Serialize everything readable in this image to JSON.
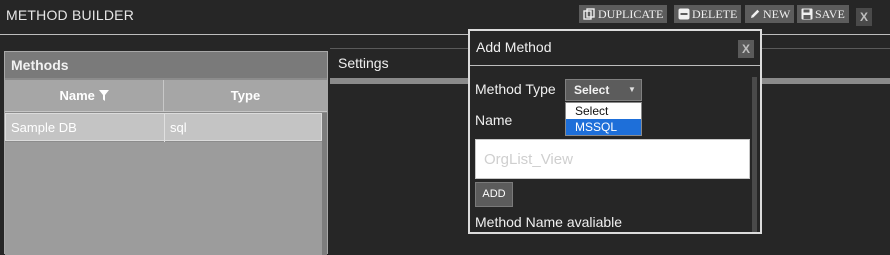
{
  "app": {
    "title": "METHOD BUILDER",
    "close_label": "X"
  },
  "toolbar": {
    "duplicate_label": "DUPLICATE",
    "delete_label": "DELETE",
    "new_label": "NEW",
    "save_label": "SAVE"
  },
  "methods_panel": {
    "title": "Methods",
    "columns": [
      "Name",
      "Type"
    ],
    "rows": [
      {
        "name": "Sample DB",
        "type": "sql"
      }
    ]
  },
  "settings": {
    "title": "Settings"
  },
  "modal": {
    "title": "Add Method",
    "close_label": "X",
    "method_type_label": "Method Type",
    "method_type_selected": "Select",
    "method_type_options": [
      "Select",
      "MSSQL"
    ],
    "name_label": "Name",
    "name_placeholder": "OrgList_View",
    "add_label": "ADD",
    "status_message": "Method Name avaliable"
  },
  "colors": {
    "background": "#262626",
    "panel": "#8c8c8c",
    "highlight": "#1e6fd9"
  }
}
